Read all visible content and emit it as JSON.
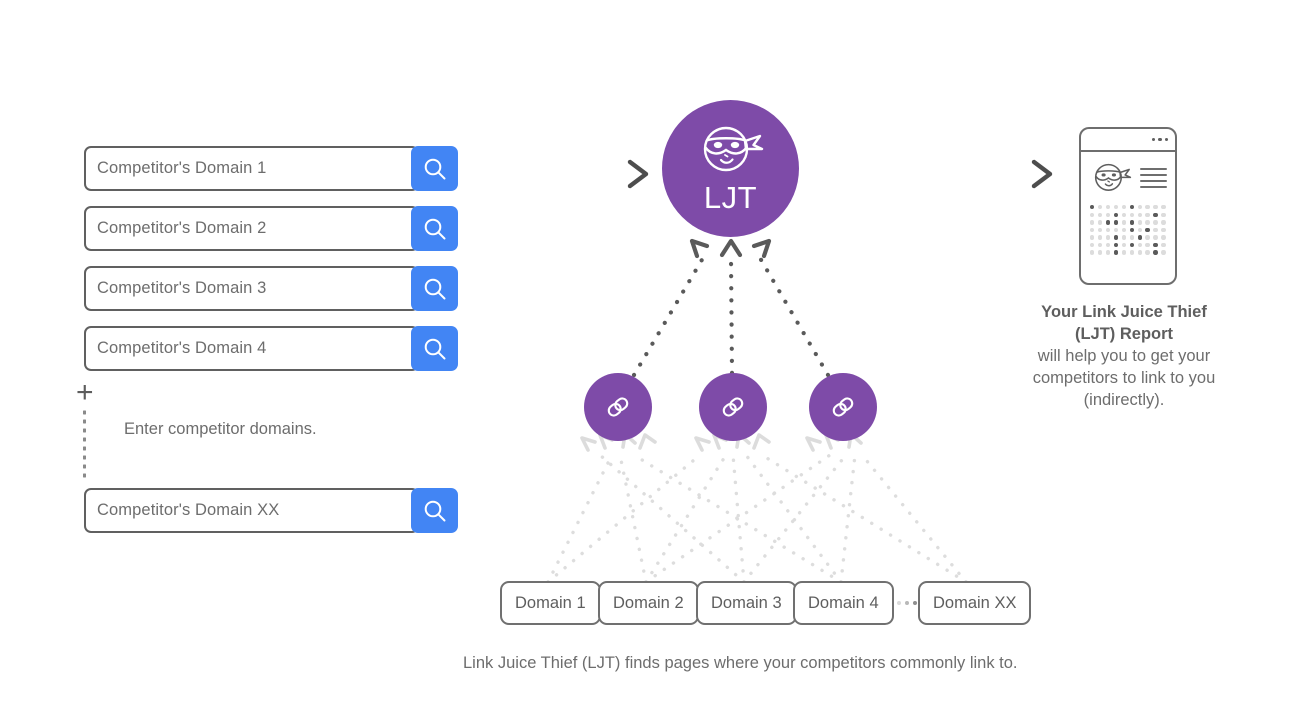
{
  "inputs": {
    "rows": [
      {
        "value": "Competitor's Domain 1",
        "icon": "search-icon"
      },
      {
        "value": "Competitor's Domain 2",
        "icon": "search-icon"
      },
      {
        "value": "Competitor's Domain 3",
        "icon": "search-icon"
      },
      {
        "value": "Competitor's Domain 4",
        "icon": "search-icon"
      },
      {
        "value": "Competitor's Domain XX",
        "icon": "search-icon"
      }
    ],
    "add_glyph": "+",
    "hint": "Enter competitor domains."
  },
  "hub": {
    "label": "LJT",
    "icon": "ninja-icon"
  },
  "link_nodes": [
    {
      "icon": "chain-link-icon"
    },
    {
      "icon": "chain-link-icon"
    },
    {
      "icon": "chain-link-icon"
    }
  ],
  "domains": {
    "boxes": [
      {
        "label": "Domain 1"
      },
      {
        "label": "Domain 2"
      },
      {
        "label": "Domain 3"
      },
      {
        "label": "Domain 4"
      },
      {
        "label": "Domain XX"
      }
    ],
    "ellipsis": "•••"
  },
  "report": {
    "icon": "ninja-icon",
    "title_line_1": "Your Link Juice Thief",
    "title_line_2": "(LJT) Report",
    "body_line_1": "will help you to get your",
    "body_line_2": "competitors to link to you",
    "body_line_3": "(indirectly).",
    "matrix": [
      [
        1,
        0,
        0,
        0,
        0,
        1,
        0,
        0,
        0,
        0
      ],
      [
        0,
        0,
        0,
        1,
        0,
        0,
        0,
        0,
        1,
        0
      ],
      [
        0,
        0,
        1,
        1,
        0,
        1,
        0,
        0,
        0,
        0
      ],
      [
        0,
        0,
        0,
        0,
        0,
        1,
        0,
        1,
        0,
        0
      ],
      [
        0,
        0,
        0,
        1,
        0,
        0,
        1,
        0,
        0,
        0
      ],
      [
        0,
        0,
        0,
        1,
        0,
        1,
        0,
        0,
        1,
        0
      ],
      [
        0,
        0,
        0,
        1,
        0,
        0,
        0,
        0,
        1,
        0
      ]
    ]
  },
  "footer": {
    "caption": "Link Juice Thief (LJT) finds pages where your competitors commonly link to."
  },
  "colors": {
    "accent_purple": "#7e4ba8",
    "search_blue": "#4285f4",
    "border_gray": "#6e6e6e",
    "text_gray": "#6d6d6d",
    "faint_gray": "#d8d8d8"
  }
}
